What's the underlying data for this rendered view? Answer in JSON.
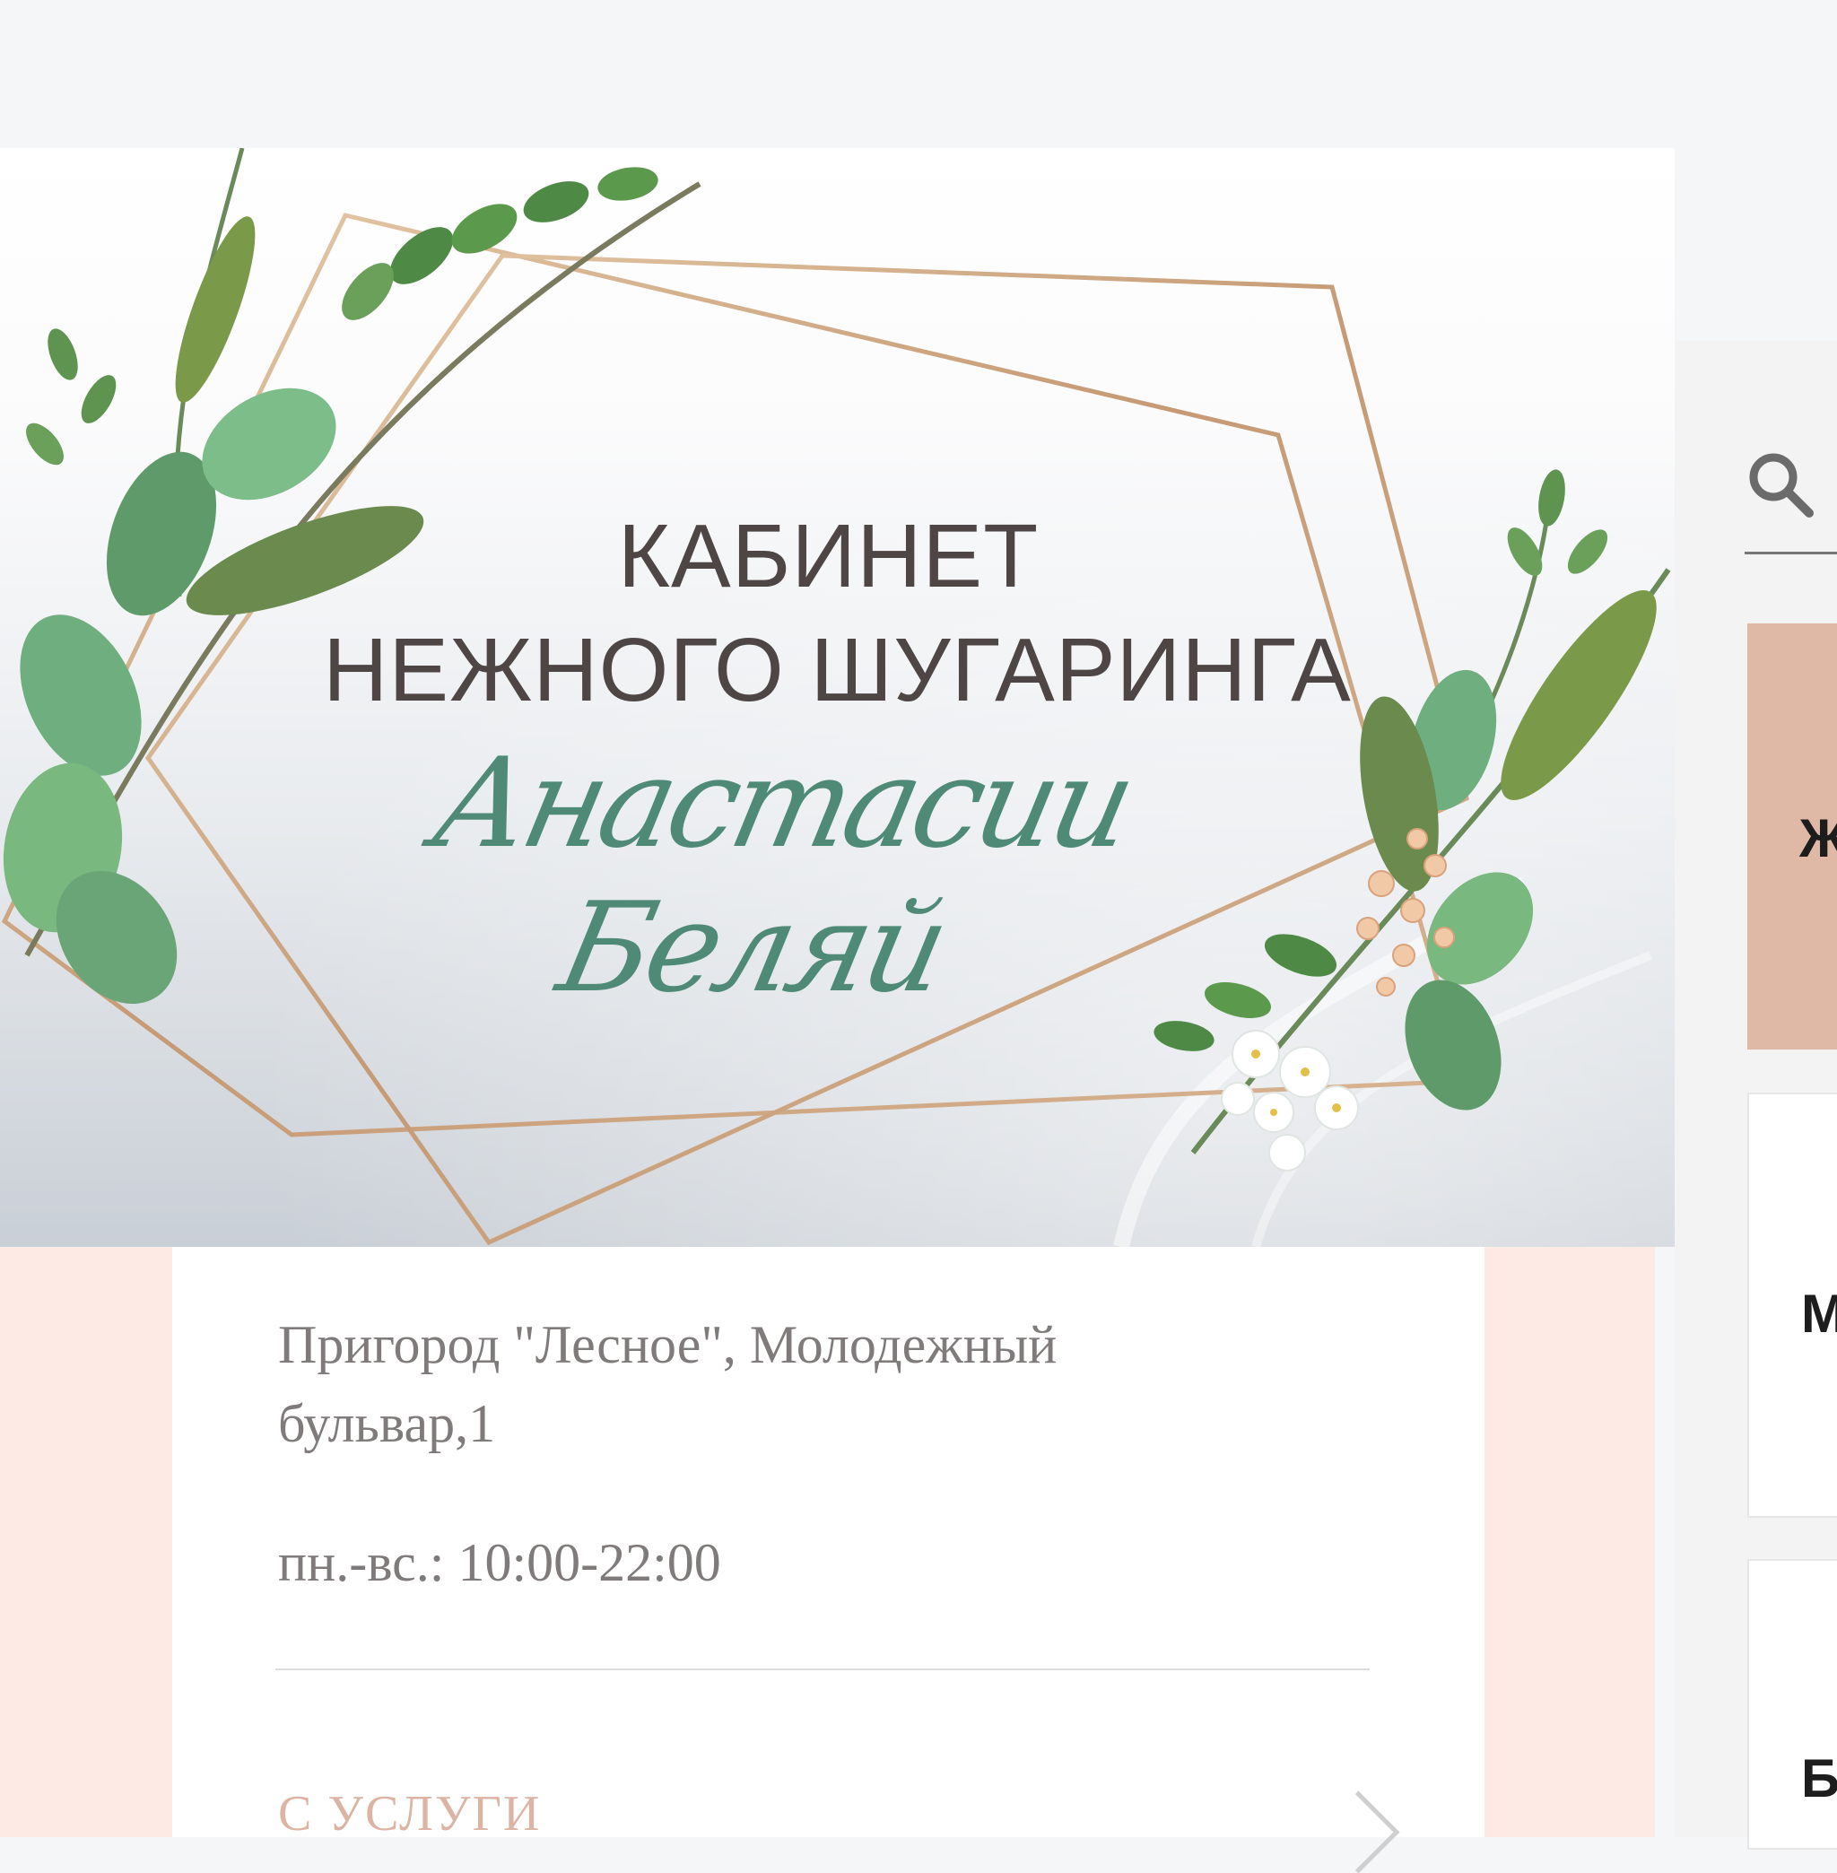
{
  "banner": {
    "title_line1": "КАБИНЕТ",
    "title_line2": "НЕЖНОГО ШУГАРИНГА",
    "signature": "Анастасии Беляй"
  },
  "info": {
    "address": "Пригород \"Лесное\", Молодежный бульвар,1",
    "hours": "пн.-вс.: 10:00-22:00",
    "services_label": "С УСЛУГИ"
  },
  "sidebar": {
    "tabs": [
      {
        "label": "Ж"
      },
      {
        "label": "М"
      },
      {
        "label": "Б"
      }
    ]
  },
  "colors": {
    "gold_frame": "#c9a07c",
    "leaf_green": "#5f9b6a",
    "signature_green": "#4f8a76",
    "pink_bg": "#fdeae4",
    "active_tab": "#dfb9a5"
  }
}
